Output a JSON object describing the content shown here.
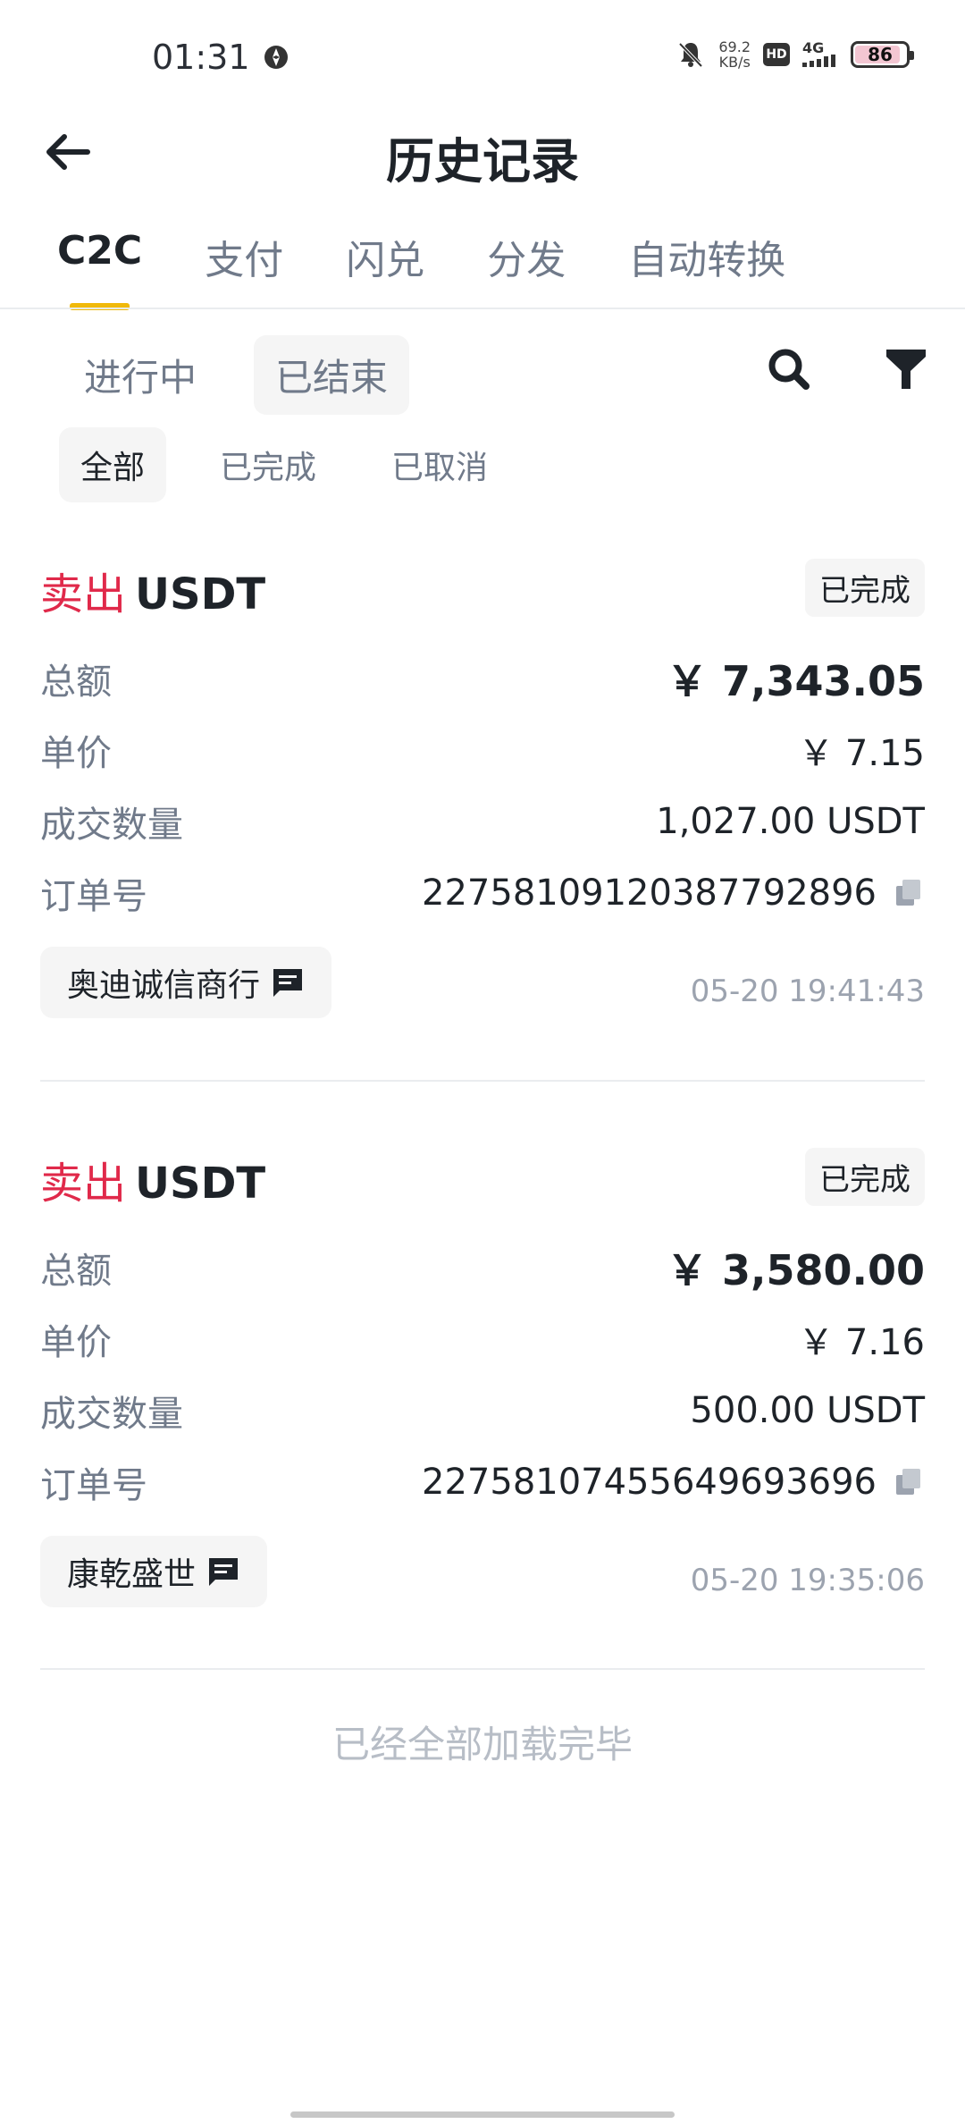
{
  "status_bar": {
    "time": "01:31",
    "net_speed_value": "69.2",
    "net_speed_unit": "KB/s",
    "hd_label": "HD",
    "network": "4G",
    "battery": "86"
  },
  "header": {
    "title": "历史记录"
  },
  "tabs": [
    {
      "label": "C2C",
      "active": true
    },
    {
      "label": "支付",
      "active": false
    },
    {
      "label": "闪兑",
      "active": false
    },
    {
      "label": "分发",
      "active": false
    },
    {
      "label": "自动转换",
      "active": false
    }
  ],
  "status_filter": {
    "ongoing": "进行中",
    "ended": "已结束"
  },
  "sub_filter": {
    "all": "全部",
    "completed": "已完成",
    "cancelled": "已取消"
  },
  "labels": {
    "total": "总额",
    "price": "单价",
    "quantity": "成交数量",
    "order_no": "订单号"
  },
  "orders": [
    {
      "side": "卖出",
      "asset": "USDT",
      "status": "已完成",
      "total": "￥ 7,343.05",
      "price": "￥ 7.15",
      "quantity": "1,027.00 USDT",
      "order_no": "22758109120387792896",
      "merchant": "奥迪诚信商行",
      "time": "05-20 19:41:43"
    },
    {
      "side": "卖出",
      "asset": "USDT",
      "status": "已完成",
      "total": "￥ 3,580.00",
      "price": "￥ 7.16",
      "quantity": "500.00 USDT",
      "order_no": "22758107455649693696",
      "merchant": "康乾盛世",
      "time": "05-20 19:35:06"
    }
  ],
  "end_note": "已经全部加载完毕",
  "colors": {
    "accent": "#f0b90b",
    "sell": "#e0294a",
    "muted": "#707a8a"
  }
}
